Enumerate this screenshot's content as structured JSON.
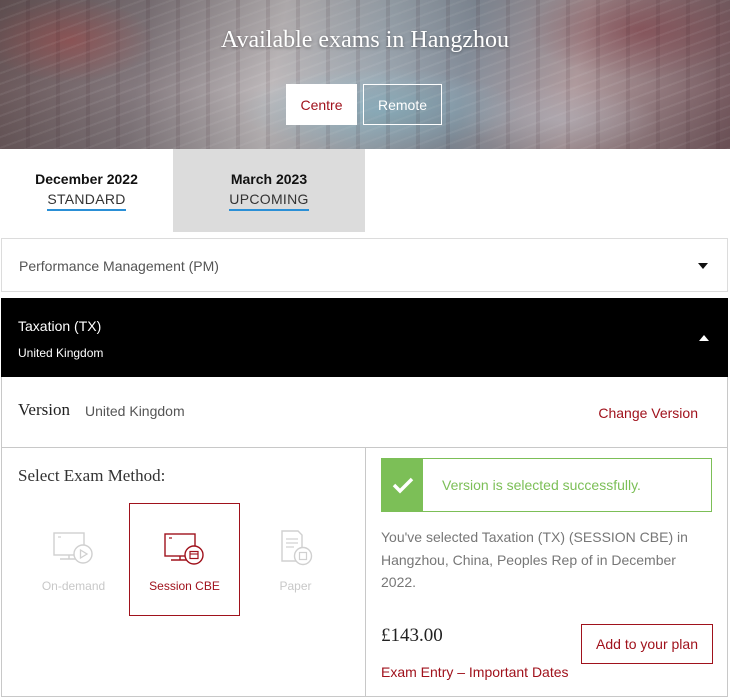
{
  "hero": {
    "title": "Available exams in Hangzhou",
    "centre_label": "Centre",
    "remote_label": "Remote"
  },
  "sessions": [
    {
      "date": "December 2022",
      "status": "STANDARD"
    },
    {
      "date": "March 2023",
      "status": "UPCOMING"
    }
  ],
  "exams": {
    "collapsed": {
      "label": "Performance Management (PM)"
    },
    "open": {
      "label": "Taxation (TX)",
      "sub": "United Kingdom"
    }
  },
  "version": {
    "label": "Version",
    "value": "United Kingdom",
    "change_label": "Change Version"
  },
  "method": {
    "title": "Select Exam Method:",
    "options": [
      {
        "label": "On-demand",
        "icon": "monitor-play-icon"
      },
      {
        "label": "Session CBE",
        "icon": "monitor-calendar-icon"
      },
      {
        "label": "Paper",
        "icon": "paper-icon"
      }
    ]
  },
  "result": {
    "success_message": "Version is selected successfully.",
    "selection_text": "You've selected Taxation (TX) (SESSION CBE) in Hangzhou, China, Peoples Rep of in December 2022.",
    "price": "£143.00",
    "add_label": "Add to your plan",
    "important_dates": "Exam Entry – Important Dates"
  },
  "colors": {
    "accent_red": "#a0121c",
    "success_green": "#7cbf57",
    "tab_underline": "#2a8fd6"
  }
}
